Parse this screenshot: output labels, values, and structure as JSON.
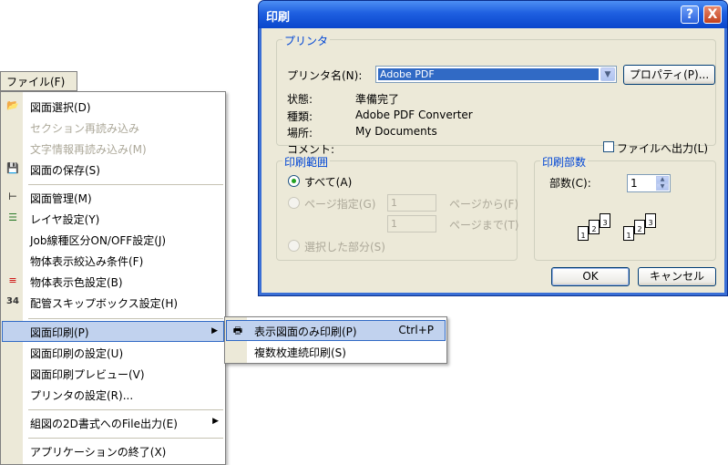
{
  "dialog": {
    "title": "印刷",
    "help_label": "?",
    "close_label": "X",
    "printer_group": {
      "legend": "プリンタ",
      "name_label": "プリンタ名(N):",
      "name_value": "Adobe PDF",
      "properties_button": "プロパティ(P)...",
      "status_label": "状態:",
      "status_value": "準備完了",
      "type_label": "種類:",
      "type_value": "Adobe PDF Converter",
      "location_label": "場所:",
      "location_value": "My Documents",
      "comment_label": "コメント:",
      "print_to_file_label": "ファイルへ出力(L)",
      "print_to_file_checked": false
    },
    "range_group": {
      "legend": "印刷範囲",
      "all_label": "すべて(A)",
      "pages_label": "ページ指定(G)",
      "from_value": "1",
      "from_suffix": "ページから(F)",
      "to_value": "1",
      "to_suffix": "ページまで(T)",
      "selection_label": "選択した部分(S)",
      "selected": "all"
    },
    "copies_group": {
      "legend": "印刷部数",
      "copies_label": "部数(C):",
      "copies_value": "1",
      "collate_pages": [
        "1",
        "2",
        "3"
      ]
    },
    "ok_button": "OK",
    "cancel_button": "キャンセル"
  },
  "menubar": {
    "file_menu_label": "ファイル(F)"
  },
  "file_menu": {
    "items": [
      {
        "label": "図面選択(D)",
        "icon": "open-folder-icon",
        "enabled": true
      },
      {
        "label": "セクション再読み込み",
        "enabled": false
      },
      {
        "label": "文字情報再読み込み(M)",
        "enabled": false
      },
      {
        "label": "図面の保存(S)",
        "icon": "floppy-disk-icon",
        "enabled": true
      },
      {
        "label": "図面管理(M)",
        "icon": "tree-icon",
        "enabled": true
      },
      {
        "label": "レイヤ設定(Y)",
        "icon": "layers-icon",
        "enabled": true
      },
      {
        "label": "Job線種区分ON/OFF設定(J)",
        "enabled": true
      },
      {
        "label": "物体表示絞込み条件(F)",
        "enabled": true
      },
      {
        "label": "物体表示色設定(B)",
        "icon": "color-lines-icon",
        "enabled": true
      },
      {
        "label": "配管スキップボックス設定(H)",
        "icon": "skip-box-icon",
        "icon_text": "34",
        "enabled": true
      },
      {
        "label": "図面印刷(P)",
        "enabled": true,
        "highlighted": true,
        "submenu": true
      },
      {
        "label": "図面印刷の設定(U)",
        "enabled": true
      },
      {
        "label": "図面印刷プレビュー(V)",
        "enabled": true
      },
      {
        "label": "プリンタの設定(R)...",
        "enabled": true
      },
      {
        "label": "組図の2D書式へのFile出力(E)",
        "enabled": true,
        "submenu": true
      },
      {
        "label": "アプリケーションの終了(X)",
        "enabled": true
      }
    ]
  },
  "print_submenu": {
    "items": [
      {
        "label": "表示図面のみ印刷(P)",
        "shortcut": "Ctrl+P",
        "icon": "printer-icon",
        "highlighted": true
      },
      {
        "label": "複数枚連続印刷(S)"
      }
    ]
  },
  "colors": {
    "title_bar": "#0a46cc",
    "menu_highlight": "#c1d2ee",
    "dialog_face": "#ece9d8",
    "legend_text": "#0046d5"
  }
}
